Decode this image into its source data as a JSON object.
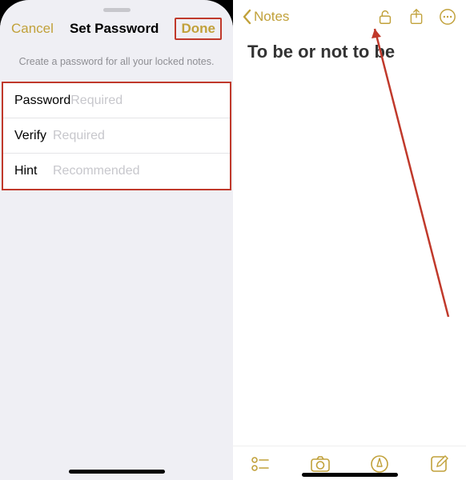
{
  "left": {
    "nav": {
      "cancel": "Cancel",
      "title": "Set Password",
      "done": "Done"
    },
    "subtitle": "Create a password for all your locked notes.",
    "fields": {
      "password": {
        "label": "Password",
        "placeholder": "Required"
      },
      "verify": {
        "label": "Verify",
        "placeholder": "Required"
      },
      "hint": {
        "label": "Hint",
        "placeholder": "Recommended"
      }
    }
  },
  "right": {
    "back_label": "Notes",
    "note_title": "To be or not to be"
  },
  "colors": {
    "accent": "#c1a13a",
    "highlight": "#c0392b"
  }
}
